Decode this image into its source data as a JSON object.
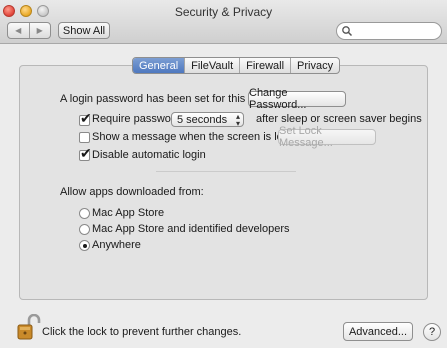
{
  "window": {
    "title": "Security & Privacy"
  },
  "toolbar": {
    "back_glyph": "◀",
    "forward_glyph": "▶",
    "show_all_label": "Show All",
    "search_placeholder": ""
  },
  "tabs": [
    {
      "label": "General",
      "active": true
    },
    {
      "label": "FileVault",
      "active": false
    },
    {
      "label": "Firewall",
      "active": false
    },
    {
      "label": "Privacy",
      "active": false
    }
  ],
  "general": {
    "login_password_text": "A login password has been set for this user",
    "change_password_label": "Change Password...",
    "require_password": {
      "checked": true,
      "label": "Require password",
      "selected": "5 seconds",
      "suffix": "after sleep or screen saver begins"
    },
    "show_message": {
      "checked": false,
      "label": "Show a message when the screen is locked",
      "button_label": "Set Lock Message..."
    },
    "disable_auto_login": {
      "checked": true,
      "label": "Disable automatic login"
    }
  },
  "downloads": {
    "heading": "Allow apps downloaded from:",
    "options": [
      {
        "label": "Mac App Store",
        "selected": false
      },
      {
        "label": "Mac App Store and identified developers",
        "selected": false
      },
      {
        "label": "Anywhere",
        "selected": true
      }
    ]
  },
  "footer": {
    "lock_text": "Click the lock to prevent further changes.",
    "advanced_label": "Advanced...",
    "help_label": "?"
  },
  "colors": {
    "active_tab": "#4e78bf",
    "lock_body": "#c98a2a"
  },
  "icons": {
    "lock": "lock-open-icon",
    "search": "search-icon"
  }
}
